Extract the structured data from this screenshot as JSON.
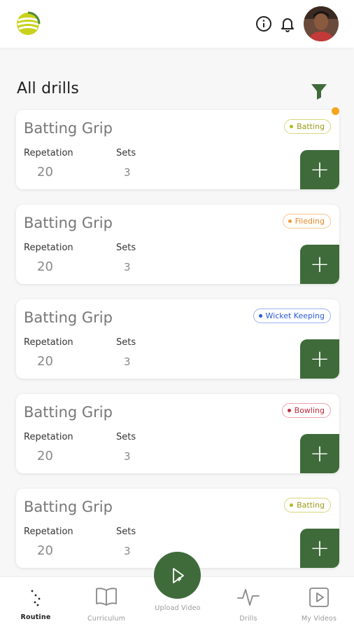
{
  "header": {
    "logo_icon": "app-logo-icon",
    "info_icon": "info-icon",
    "bell_icon": "bell-icon",
    "avatar_icon": "user-avatar"
  },
  "page": {
    "title": "All drills"
  },
  "drills": [
    {
      "title": "Batting Grip",
      "rep_label": "Repetation",
      "sets_label": "Sets",
      "repetition": "20",
      "sets": "3",
      "tag": "Batting",
      "tag_color": "#b8b820"
    },
    {
      "title": "Batting Grip",
      "rep_label": "Repetation",
      "sets_label": "Sets",
      "repetition": "20",
      "sets": "3",
      "tag": "Fileding",
      "tag_color": "#f09a3a"
    },
    {
      "title": "Batting Grip",
      "rep_label": "Repetation",
      "sets_label": "Sets",
      "repetition": "20",
      "sets": "3",
      "tag": "Wicket Keeping",
      "tag_color": "#2a5bd7"
    },
    {
      "title": "Batting Grip",
      "rep_label": "Repetation",
      "sets_label": "Sets",
      "repetition": "20",
      "sets": "3",
      "tag": "Bowling",
      "tag_color": "#c0283a"
    },
    {
      "title": "Batting Grip",
      "rep_label": "Repetation",
      "sets_label": "Sets",
      "repetition": "20",
      "sets": "3",
      "tag": "Batting",
      "tag_color": "#b8b820"
    }
  ],
  "nav": {
    "routine": "Routine",
    "curriculum": "Curriculum",
    "upload": "Upload Video",
    "drills": "Drills",
    "my_videos": "My Videos"
  },
  "colors": {
    "accent": "#3f6b3a",
    "notification_dot": "#f4a51c"
  }
}
